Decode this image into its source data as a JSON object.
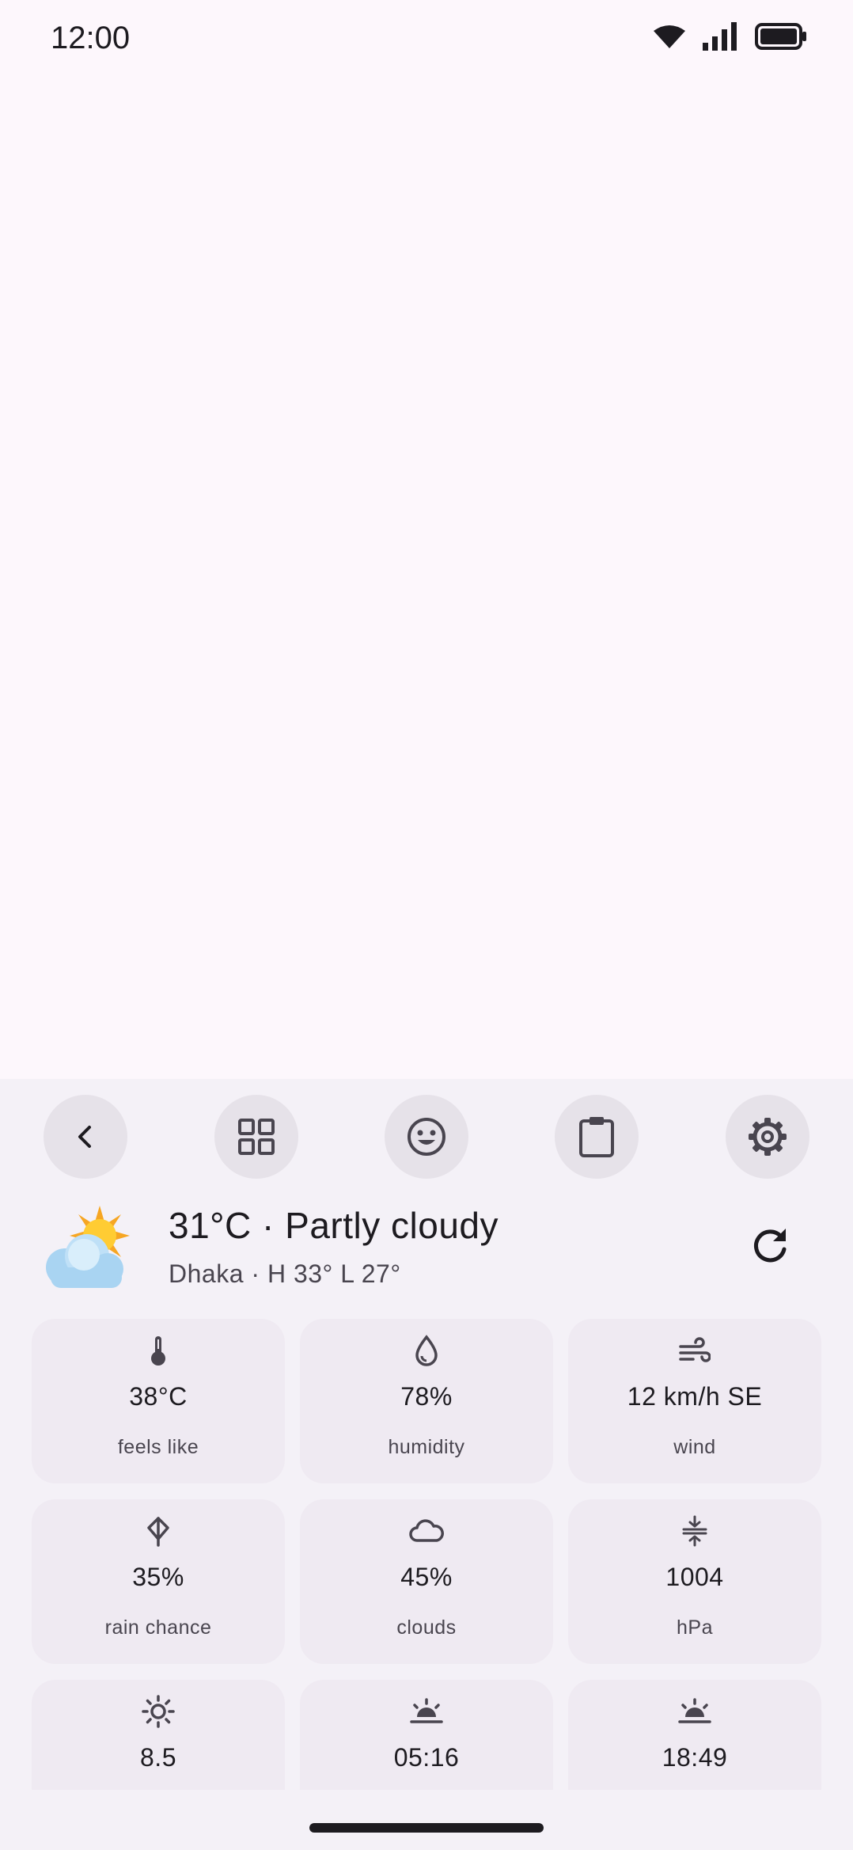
{
  "status_bar": {
    "time": "12:00"
  },
  "toolbar": {
    "buttons": [
      {
        "icon": "chevron-left-icon"
      },
      {
        "icon": "grid-icon"
      },
      {
        "icon": "emoji-icon"
      },
      {
        "icon": "clipboard-icon"
      },
      {
        "icon": "gear-icon"
      }
    ]
  },
  "weather": {
    "title": "31°C · Partly cloudy",
    "subtitle": "Dhaka · H 33° L 27°",
    "tiles": [
      {
        "icon": "thermometer-icon",
        "value": "38°C",
        "label": "feels like"
      },
      {
        "icon": "water-drop-icon",
        "value": "78%",
        "label": "humidity"
      },
      {
        "icon": "wind-icon",
        "value": "12 km/h SE",
        "label": "wind"
      },
      {
        "icon": "umbrella-icon",
        "value": "35%",
        "label": "rain chance"
      },
      {
        "icon": "cloud-icon",
        "value": "45%",
        "label": "clouds"
      },
      {
        "icon": "pressure-icon",
        "value": "1004",
        "label": "hPa"
      },
      {
        "icon": "sun-icon",
        "value": "8.5",
        "label": ""
      },
      {
        "icon": "sunrise-icon",
        "value": "05:16",
        "label": ""
      },
      {
        "icon": "sunset-icon",
        "value": "18:49",
        "label": ""
      }
    ]
  },
  "colors": {
    "background": "#fdf7fc",
    "panel": "#f4f1f7",
    "tile": "#efeaf2",
    "button": "#e6e2e9",
    "icon": "#49454f",
    "text": "#1d1b20"
  }
}
